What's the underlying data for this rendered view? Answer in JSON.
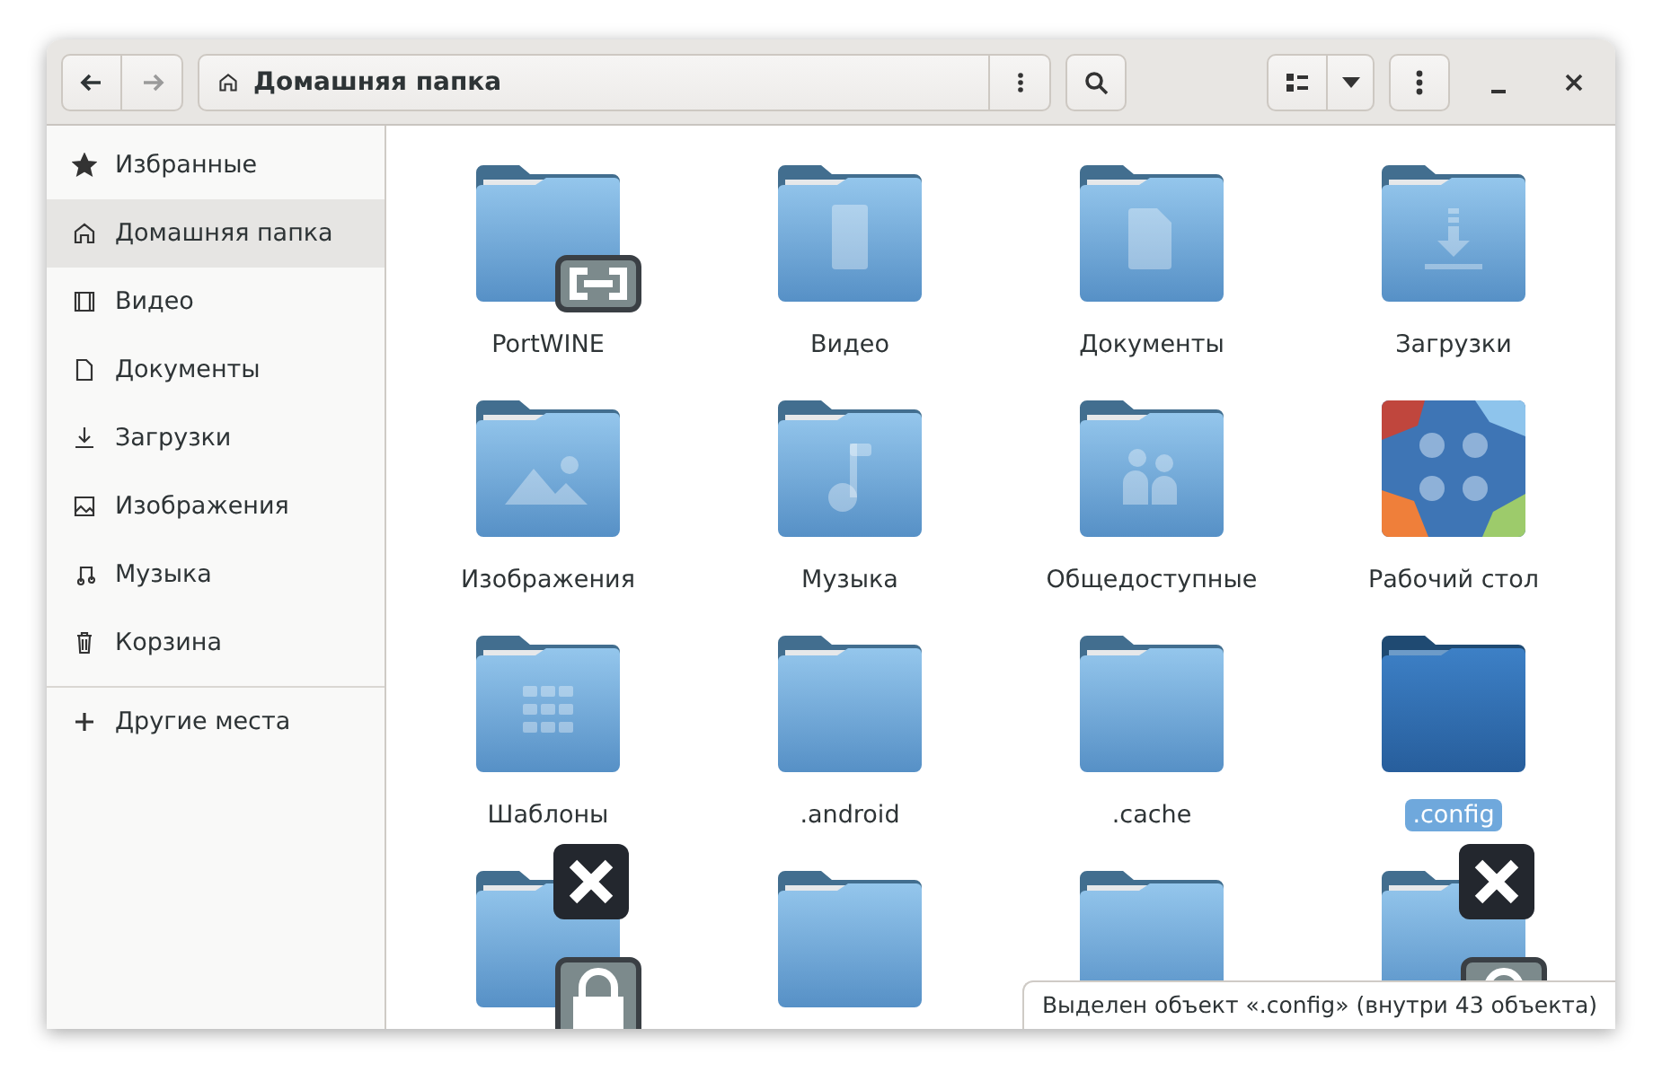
{
  "window": {
    "title": "Домашняя папка"
  },
  "toolbar": {
    "back": {
      "disabled": false
    },
    "forward": {
      "disabled": true
    }
  },
  "sidebar": {
    "items": [
      {
        "label": "Избранные",
        "kind": "star",
        "selected": false
      },
      {
        "label": "Домашняя папка",
        "kind": "home",
        "selected": true
      },
      {
        "label": "Видео",
        "kind": "video",
        "selected": false
      },
      {
        "label": "Документы",
        "kind": "document",
        "selected": false
      },
      {
        "label": "Загрузки",
        "kind": "download",
        "selected": false
      },
      {
        "label": "Изображения",
        "kind": "image",
        "selected": false
      },
      {
        "label": "Музыка",
        "kind": "music",
        "selected": false
      },
      {
        "label": "Корзина",
        "kind": "trash",
        "selected": false
      }
    ],
    "other": [
      {
        "label": "Другие места",
        "kind": "plus",
        "selected": false
      }
    ]
  },
  "files": [
    {
      "label": "PortWINE",
      "kind": "folder",
      "linked": true,
      "unreadable": false,
      "locked": false,
      "selected": false
    },
    {
      "label": "Видео",
      "kind": "video",
      "linked": false,
      "unreadable": false,
      "locked": false,
      "selected": false
    },
    {
      "label": "Документы",
      "kind": "document",
      "linked": false,
      "unreadable": false,
      "locked": false,
      "selected": false
    },
    {
      "label": "Загрузки",
      "kind": "download",
      "linked": false,
      "unreadable": false,
      "locked": false,
      "selected": false
    },
    {
      "label": "Изображения",
      "kind": "image",
      "linked": false,
      "unreadable": false,
      "locked": false,
      "selected": false
    },
    {
      "label": "Музыка",
      "kind": "music",
      "linked": false,
      "unreadable": false,
      "locked": false,
      "selected": false
    },
    {
      "label": "Общедоступные",
      "kind": "public",
      "linked": false,
      "unreadable": false,
      "locked": false,
      "selected": false
    },
    {
      "label": "Рабочий стол",
      "kind": "desktop",
      "linked": false,
      "unreadable": false,
      "locked": false,
      "selected": false
    },
    {
      "label": "Шаблоны",
      "kind": "templates",
      "linked": false,
      "unreadable": false,
      "locked": false,
      "selected": false
    },
    {
      "label": ".android",
      "kind": "folder",
      "linked": false,
      "unreadable": false,
      "locked": false,
      "selected": false
    },
    {
      "label": ".cache",
      "kind": "folder",
      "linked": false,
      "unreadable": false,
      "locked": false,
      "selected": false
    },
    {
      "label": ".config",
      "kind": "folder",
      "linked": false,
      "unreadable": false,
      "locked": false,
      "selected": true
    },
    {
      "kind": "folder",
      "linked": false,
      "unreadable": true,
      "locked": true,
      "selected": false
    },
    {
      "kind": "folder",
      "linked": false,
      "unreadable": false,
      "locked": false,
      "selected": false
    },
    {
      "kind": "folder",
      "linked": false,
      "unreadable": false,
      "locked": false,
      "selected": false
    },
    {
      "kind": "folder",
      "linked": false,
      "unreadable": true,
      "locked": true,
      "selected": false
    }
  ],
  "status_bar": "Выделен объект «.config» (внутри 43 объекта)"
}
